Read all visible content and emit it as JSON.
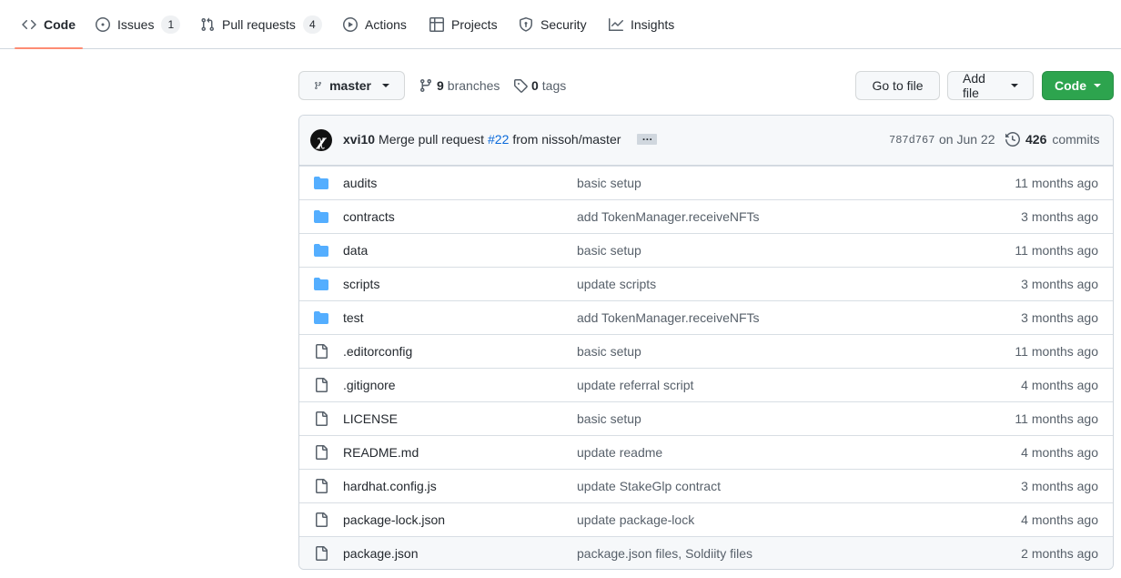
{
  "tabs": [
    {
      "label": "Code",
      "icon": "code-icon",
      "selected": true
    },
    {
      "label": "Issues",
      "icon": "issue-opened-icon",
      "count": "1"
    },
    {
      "label": "Pull requests",
      "icon": "git-pull-request-icon",
      "count": "4"
    },
    {
      "label": "Actions",
      "icon": "play-icon"
    },
    {
      "label": "Projects",
      "icon": "table-icon"
    },
    {
      "label": "Security",
      "icon": "shield-icon"
    },
    {
      "label": "Insights",
      "icon": "graph-icon"
    }
  ],
  "toolbar": {
    "branch_label": "master",
    "branches_count": "9",
    "branches_label": "branches",
    "tags_count": "0",
    "tags_label": "tags",
    "go_to_file_label": "Go to file",
    "add_file_label": "Add file",
    "code_label": "Code",
    "code_button_color": "#2da44e"
  },
  "latest_commit": {
    "author": "xvi10",
    "message_prefix": "Merge pull request",
    "pr_ref": "#22",
    "message_suffix": "from nissoh/master",
    "ellipsis": "…",
    "sha": "787d767",
    "date": "on Jun 22",
    "commits_count": "426",
    "commits_label": "commits",
    "avatar_glyph": "χ"
  },
  "files": [
    {
      "name": "audits",
      "type": "dir",
      "message": "basic setup",
      "age": "11 months ago"
    },
    {
      "name": "contracts",
      "type": "dir",
      "message": "add TokenManager.receiveNFTs",
      "age": "3 months ago"
    },
    {
      "name": "data",
      "type": "dir",
      "message": "basic setup",
      "age": "11 months ago"
    },
    {
      "name": "scripts",
      "type": "dir",
      "message": "update scripts",
      "age": "3 months ago"
    },
    {
      "name": "test",
      "type": "dir",
      "message": "add TokenManager.receiveNFTs",
      "age": "3 months ago"
    },
    {
      "name": ".editorconfig",
      "type": "file",
      "message": "basic setup",
      "age": "11 months ago"
    },
    {
      "name": ".gitignore",
      "type": "file",
      "message": "update referral script",
      "age": "4 months ago"
    },
    {
      "name": "LICENSE",
      "type": "file",
      "message": "basic setup",
      "age": "11 months ago"
    },
    {
      "name": "README.md",
      "type": "file",
      "message": "update readme",
      "age": "4 months ago"
    },
    {
      "name": "hardhat.config.js",
      "type": "file",
      "message": "update StakeGlp contract",
      "age": "3 months ago"
    },
    {
      "name": "package-lock.json",
      "type": "file",
      "message": "update package-lock",
      "age": "4 months ago"
    },
    {
      "name": "package.json",
      "type": "file",
      "message": "package.json files, Soldiity files",
      "age": "2 months ago"
    }
  ],
  "colors": {
    "accent_tab_underline": "#fd8c73",
    "folder_icon": "#54aeff",
    "link": "#0969da"
  }
}
